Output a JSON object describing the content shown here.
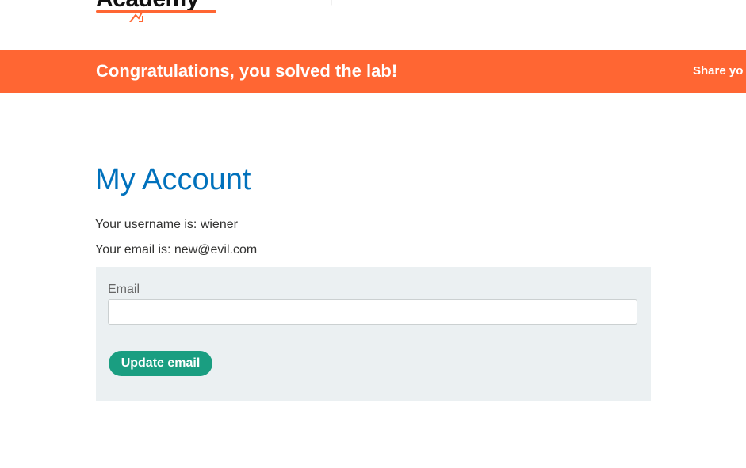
{
  "header": {
    "logo_text": "Academy",
    "logo_faded_text": "· · · · · · | · · ·",
    "brand_color": "#ff6633"
  },
  "banner": {
    "message": "Congratulations, you solved the lab!",
    "share_text": "Share yo",
    "background_color": "#ff6633"
  },
  "main": {
    "title": "My Account",
    "username_line": "Your username is: wiener",
    "email_line": "Your email is: new@evil.com"
  },
  "form": {
    "email_label": "Email",
    "email_value": "",
    "email_placeholder": "",
    "submit_label": "Update email",
    "button_color": "#1a9e81"
  }
}
